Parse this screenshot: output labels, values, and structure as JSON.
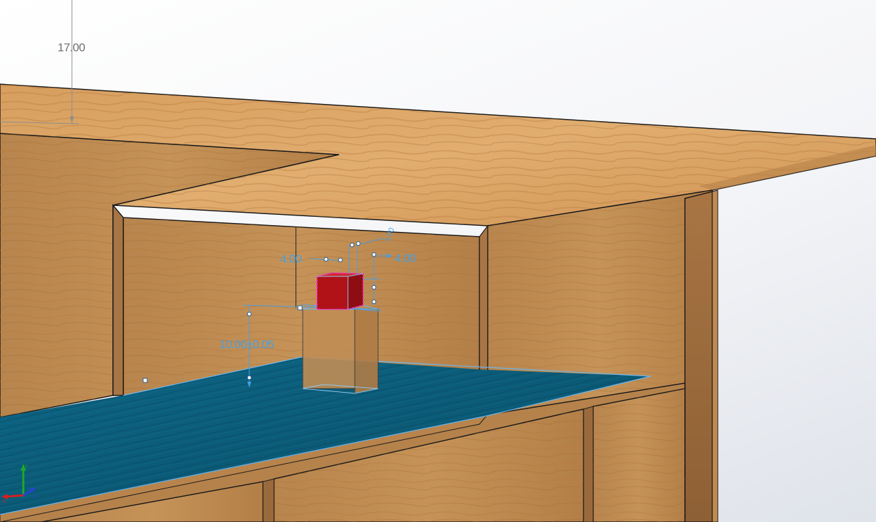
{
  "viewport": {
    "dimensions": {
      "top_height": "17.00",
      "width_left": "4.00",
      "width_right": "4.00",
      "depth_small": "4.00",
      "post_height": "10.00±0.05"
    },
    "triad": {
      "x": "X",
      "y": "Y",
      "z": "Z"
    },
    "colors": {
      "wood": "#c8955a",
      "floor": "#0b5f7d",
      "cube": "#b01217",
      "sketch_line": "#4a9fe0",
      "selection": "#ff1fd0"
    }
  }
}
